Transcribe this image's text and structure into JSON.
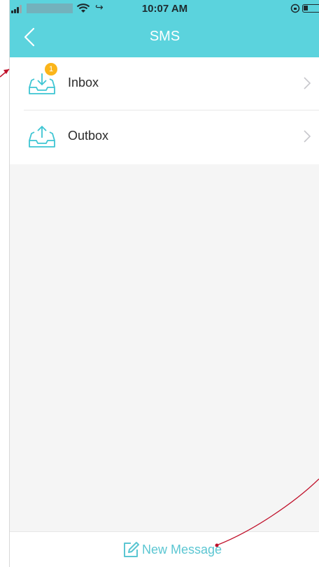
{
  "status_bar": {
    "time": "10:07 AM"
  },
  "nav": {
    "title": "SMS",
    "back_icon": "chevron-left-icon"
  },
  "list": {
    "items": [
      {
        "label": "Inbox",
        "icon": "inbox-download-icon",
        "badge": "1"
      },
      {
        "label": "Outbox",
        "icon": "outbox-upload-icon"
      }
    ]
  },
  "bottom": {
    "new_message_label": "New Message",
    "icon": "compose-icon"
  },
  "colors": {
    "accent": "#5bd3dd",
    "accent_text": "#5bc6d2",
    "badge": "#fbb51a",
    "annotation": "#c0102a"
  }
}
